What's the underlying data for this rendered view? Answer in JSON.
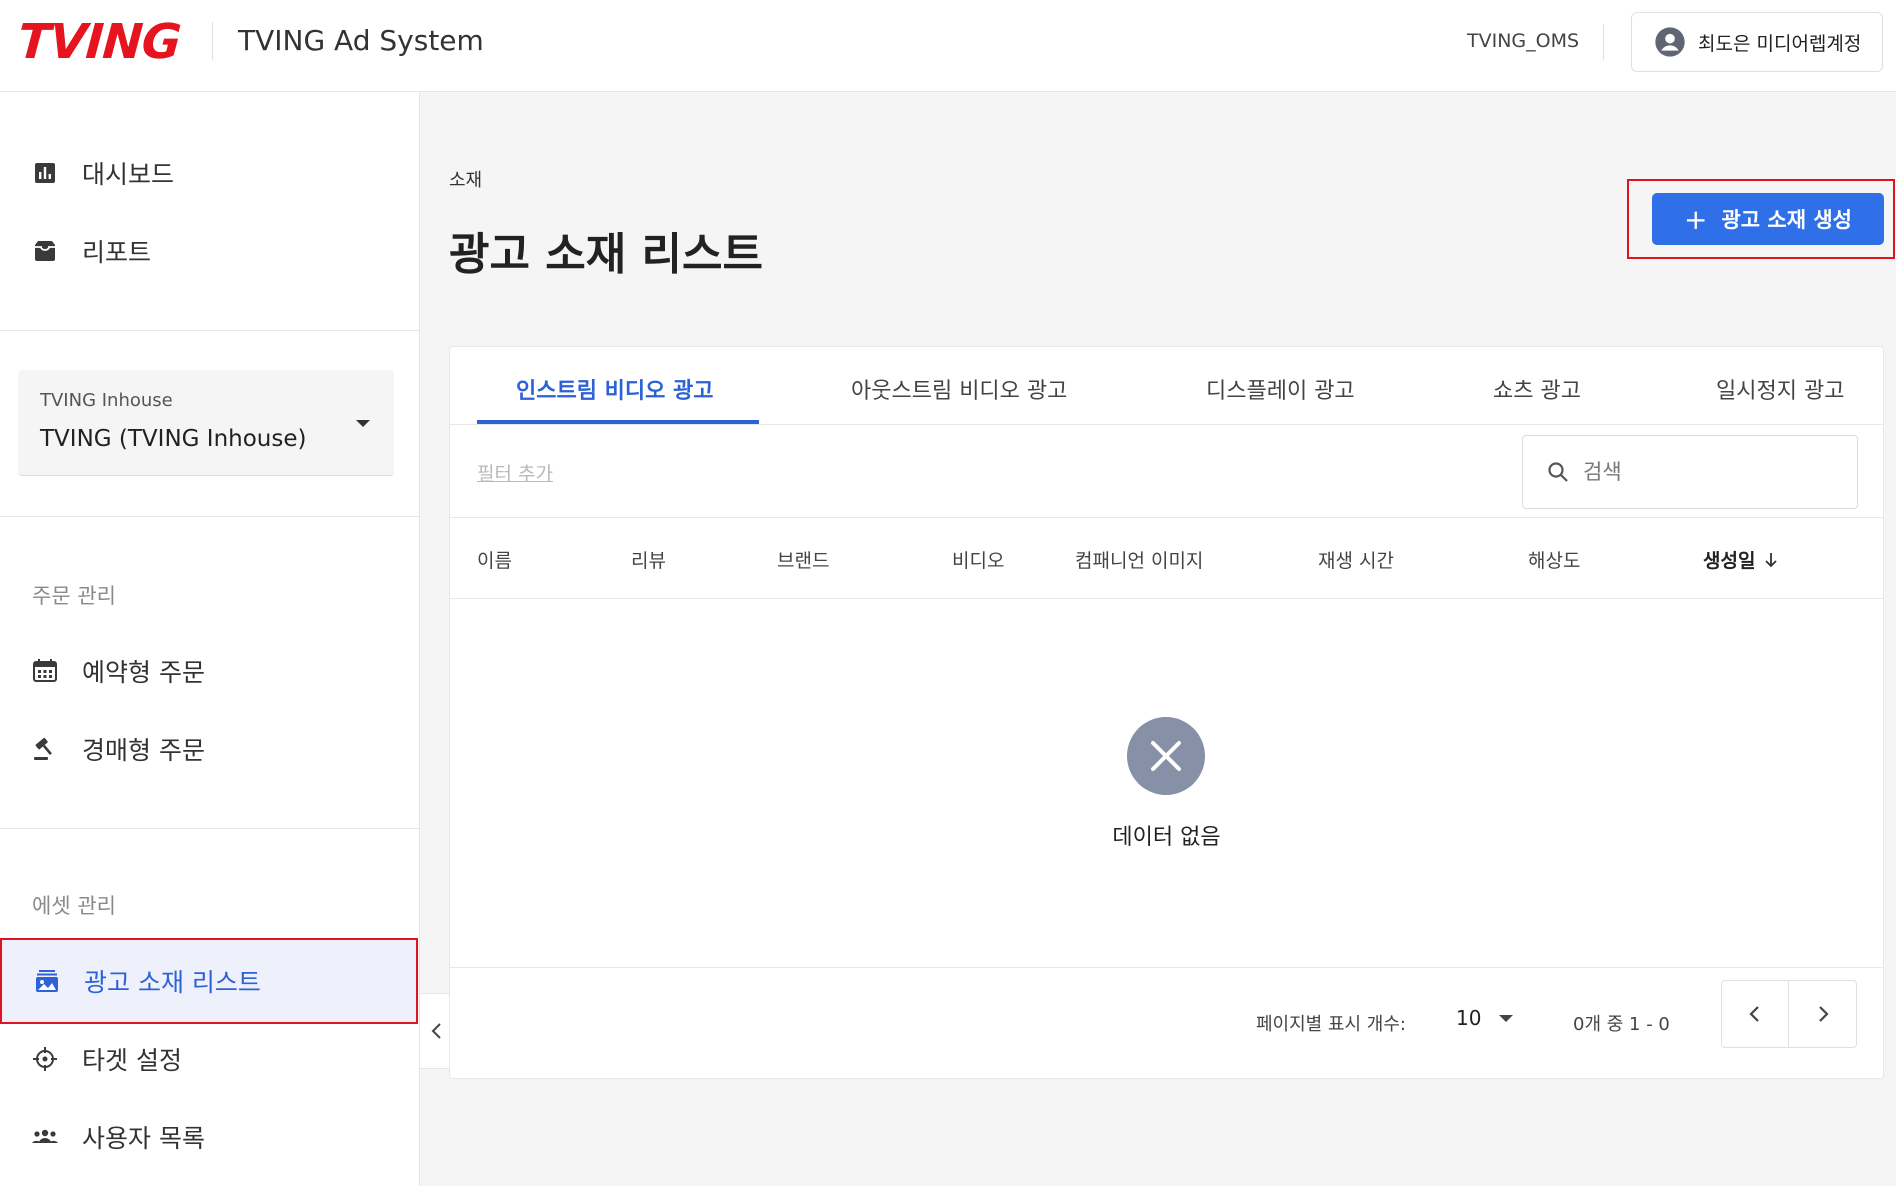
{
  "header": {
    "logo": "TVING",
    "app_title": "TVING Ad System",
    "tenant": "TVING_OMS",
    "account_name": "최도은 미디어렙계정"
  },
  "sidebar": {
    "top_items": [
      {
        "label": "대시보드",
        "icon": "bar-chart-icon"
      },
      {
        "label": "리포트",
        "icon": "inbox-icon"
      }
    ],
    "org_select": {
      "label": "TVING Inhouse",
      "value": "TVING (TVING Inhouse)"
    },
    "order_section": {
      "label": "주문 관리",
      "items": [
        {
          "label": "예약형 주문",
          "icon": "calendar-icon"
        },
        {
          "label": "경매형 주문",
          "icon": "gavel-icon"
        }
      ]
    },
    "asset_section": {
      "label": "에셋 관리",
      "items": [
        {
          "label": "광고 소재 리스트",
          "icon": "image-stack-icon",
          "active": true
        },
        {
          "label": "타겟 설정",
          "icon": "crosshair-icon"
        },
        {
          "label": "사용자 목록",
          "icon": "group-icon"
        }
      ]
    }
  },
  "main": {
    "breadcrumb": "소재",
    "title": "광고 소재 리스트",
    "create_button": "광고 소재 생성",
    "tabs": [
      {
        "label": "인스트림 비디오 광고",
        "active": true
      },
      {
        "label": "아웃스트림 비디오 광고"
      },
      {
        "label": "디스플레이 광고"
      },
      {
        "label": "쇼츠 광고"
      },
      {
        "label": "일시정지 광고"
      }
    ],
    "filter_link": "필터 추가",
    "search_placeholder": "검색",
    "columns": [
      "이름",
      "리뷰",
      "브랜드",
      "비디오",
      "컴패니언 이미지",
      "재생 시간",
      "해상도",
      "생성일"
    ],
    "empty_text": "데이터 없음",
    "pagination": {
      "rows_label": "페이지별 표시 개수:",
      "rows_value": "10",
      "range": "0개 중 1 - 0"
    }
  },
  "colors": {
    "brand": "#e5141e",
    "accent": "#2c62d6",
    "primary_button": "#2f6fe8"
  }
}
